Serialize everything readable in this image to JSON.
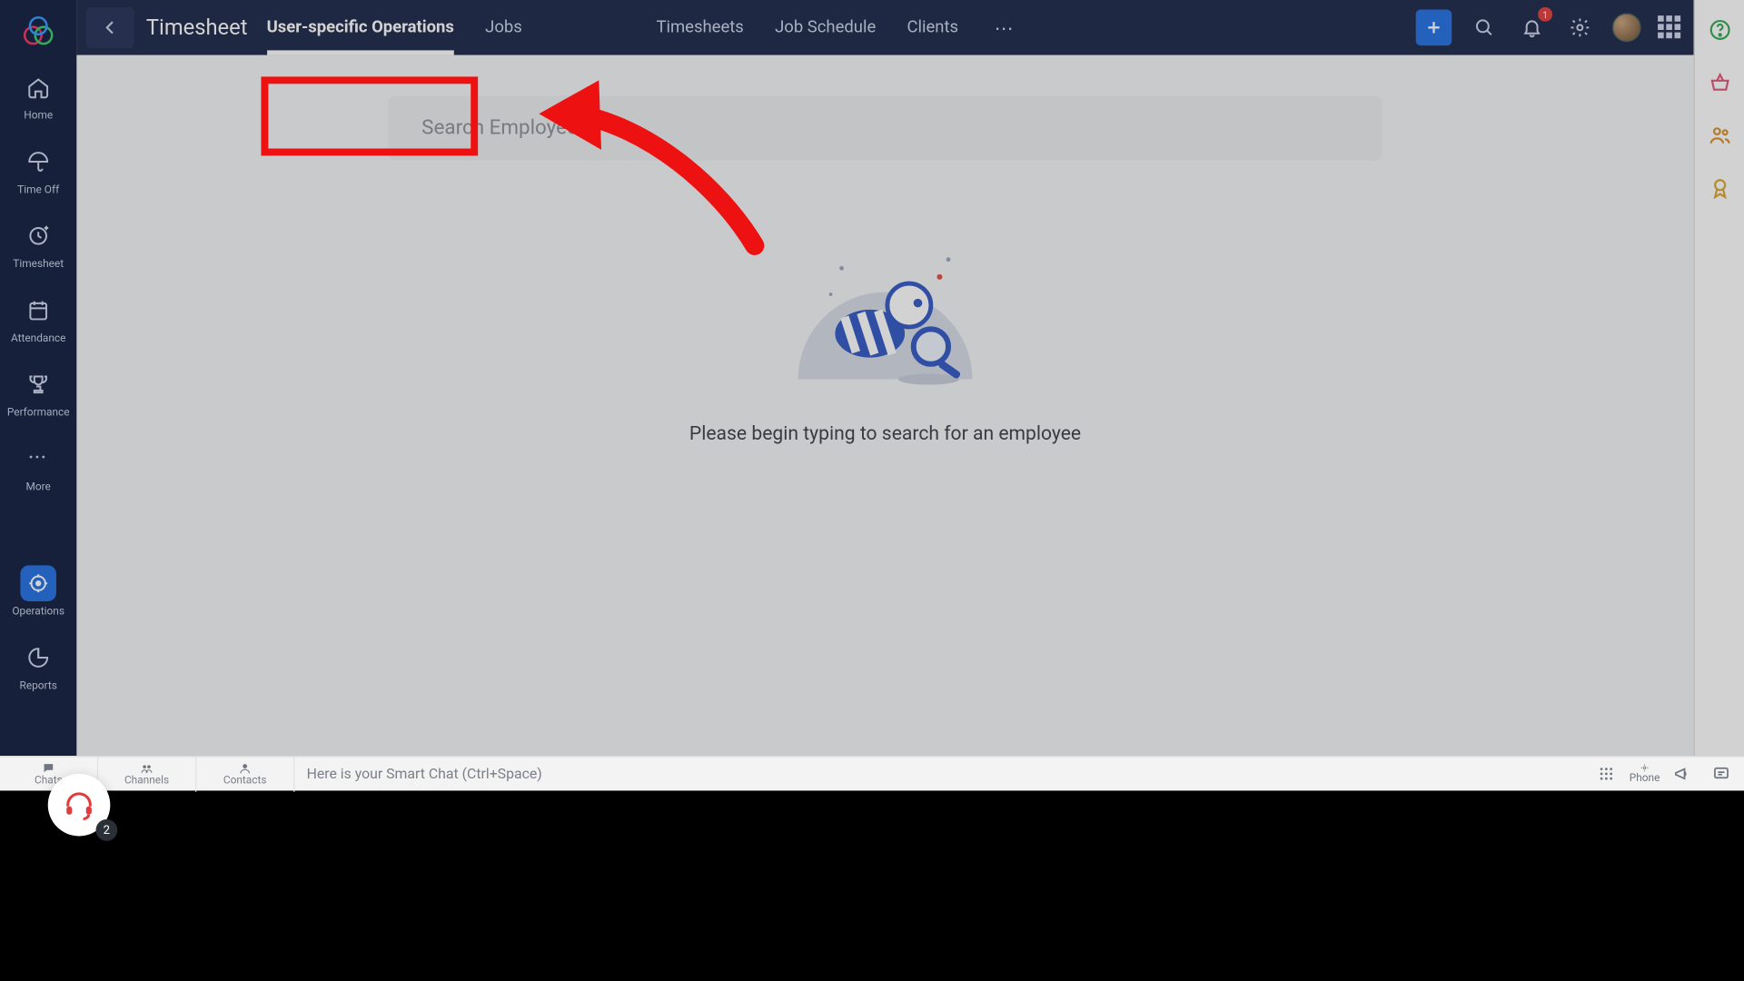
{
  "header": {
    "section_title": "Timesheet",
    "notification_count": "1"
  },
  "tabs": [
    {
      "label": "User-specific Operations",
      "active": true
    },
    {
      "label": "Jobs",
      "active": false
    },
    {
      "label": "Timesheets",
      "active": false
    },
    {
      "label": "Job Schedule",
      "active": false
    },
    {
      "label": "Clients",
      "active": false
    }
  ],
  "rail": [
    {
      "label": "Home"
    },
    {
      "label": "Time Off"
    },
    {
      "label": "Timesheet"
    },
    {
      "label": "Attendance"
    },
    {
      "label": "Performance"
    },
    {
      "label": "More"
    },
    {
      "label": "Operations",
      "active": true
    },
    {
      "label": "Reports"
    }
  ],
  "search": {
    "placeholder": "Search Employee"
  },
  "empty_state": {
    "hint": "Please begin typing to search for an employee"
  },
  "chatbar": {
    "tabs": [
      {
        "label": "Chats"
      },
      {
        "label": "Channels"
      },
      {
        "label": "Contacts"
      }
    ],
    "placeholder": "Here is your Smart Chat (Ctrl+Space)",
    "phone_label": "Phone"
  },
  "help_bubble": {
    "count": "2"
  },
  "colors": {
    "accent": "#1f6fe5",
    "navy": "#1a2647",
    "rail": "#0f1b3d",
    "danger": "#e11"
  }
}
